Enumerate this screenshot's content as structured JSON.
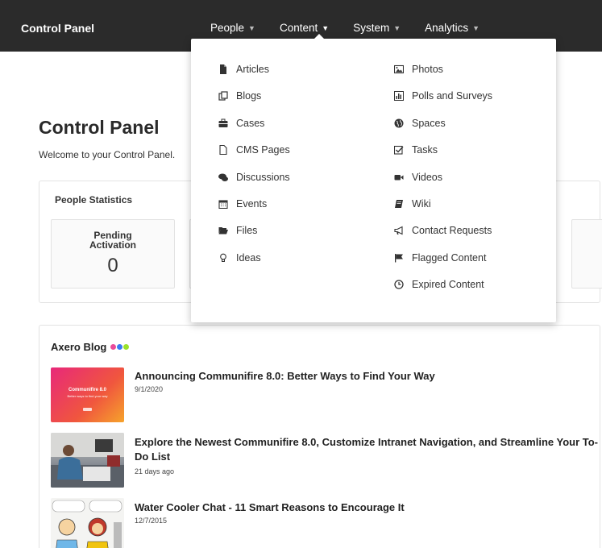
{
  "app": {
    "title": "Control Panel"
  },
  "nav": [
    {
      "label": "People"
    },
    {
      "label": "Content"
    },
    {
      "label": "System"
    },
    {
      "label": "Analytics"
    }
  ],
  "dropdown": {
    "left_column": [
      {
        "label": "Articles",
        "icon": "file-icon"
      },
      {
        "label": "Blogs",
        "icon": "copy-icon"
      },
      {
        "label": "Cases",
        "icon": "briefcase-icon"
      },
      {
        "label": "CMS Pages",
        "icon": "page-icon"
      },
      {
        "label": "Discussions",
        "icon": "comments-icon"
      },
      {
        "label": "Events",
        "icon": "calendar-icon"
      },
      {
        "label": "Files",
        "icon": "folder-open-icon"
      },
      {
        "label": "Ideas",
        "icon": "lightbulb-icon"
      }
    ],
    "right_column": [
      {
        "label": "Photos",
        "icon": "image-icon"
      },
      {
        "label": "Polls and Surveys",
        "icon": "bar-chart-icon"
      },
      {
        "label": "Spaces",
        "icon": "globe-icon"
      },
      {
        "label": "Tasks",
        "icon": "check-square-icon"
      },
      {
        "label": "Videos",
        "icon": "video-camera-icon"
      },
      {
        "label": "Wiki",
        "icon": "book-icon"
      },
      {
        "label": "Contact Requests",
        "icon": "bullhorn-icon"
      },
      {
        "label": "Flagged Content",
        "icon": "flag-icon"
      },
      {
        "label": "Expired Content",
        "icon": "clock-icon"
      }
    ]
  },
  "main": {
    "title": "Control Panel",
    "welcome": "Welcome to your Control Panel."
  },
  "people_stats": {
    "title": "People Statistics",
    "tiles": [
      {
        "label": "Pending Activation",
        "value": "0"
      }
    ]
  },
  "blog": {
    "title": "Axero Blog",
    "dot_colors": [
      "#e94c9a",
      "#3a7bf3",
      "#9be22d"
    ],
    "posts": [
      {
        "title": "Announcing Communifire 8.0: Better Ways to Find Your Way",
        "date": "9/1/2020",
        "thumb_title": "Communifire 8.0",
        "thumb_subtitle": "Better ways to find your way"
      },
      {
        "title": "Explore the Newest Communifire 8.0, Customize Intranet Navigation, and Streamline Your To-Do List",
        "date": "21 days ago"
      },
      {
        "title": "Water Cooler Chat - 11 Smart Reasons to Encourage It",
        "date": "12/7/2015"
      }
    ]
  },
  "colors": {
    "topbar": "#2b2b2b",
    "accent_pink": "#e8287a"
  }
}
